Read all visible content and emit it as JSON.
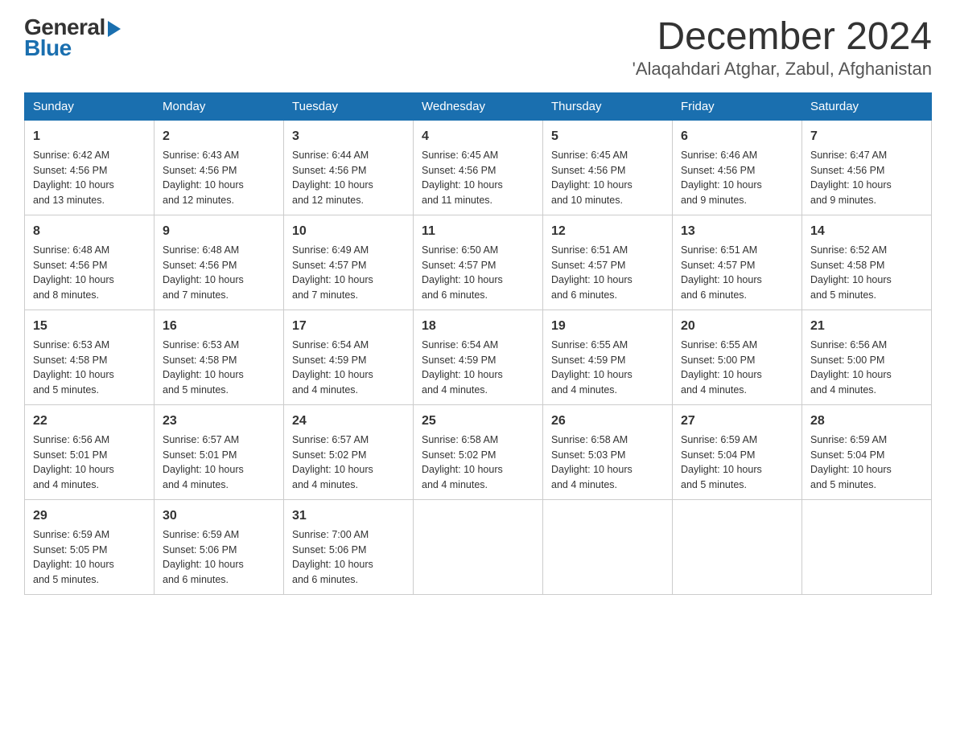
{
  "header": {
    "logo_general": "General",
    "logo_blue": "Blue",
    "month_title": "December 2024",
    "location": "'Alaqahdari Atghar, Zabul, Afghanistan"
  },
  "weekdays": [
    "Sunday",
    "Monday",
    "Tuesday",
    "Wednesday",
    "Thursday",
    "Friday",
    "Saturday"
  ],
  "weeks": [
    [
      {
        "day": "1",
        "sunrise": "6:42 AM",
        "sunset": "4:56 PM",
        "daylight": "10 hours and 13 minutes."
      },
      {
        "day": "2",
        "sunrise": "6:43 AM",
        "sunset": "4:56 PM",
        "daylight": "10 hours and 12 minutes."
      },
      {
        "day": "3",
        "sunrise": "6:44 AM",
        "sunset": "4:56 PM",
        "daylight": "10 hours and 12 minutes."
      },
      {
        "day": "4",
        "sunrise": "6:45 AM",
        "sunset": "4:56 PM",
        "daylight": "10 hours and 11 minutes."
      },
      {
        "day": "5",
        "sunrise": "6:45 AM",
        "sunset": "4:56 PM",
        "daylight": "10 hours and 10 minutes."
      },
      {
        "day": "6",
        "sunrise": "6:46 AM",
        "sunset": "4:56 PM",
        "daylight": "10 hours and 9 minutes."
      },
      {
        "day": "7",
        "sunrise": "6:47 AM",
        "sunset": "4:56 PM",
        "daylight": "10 hours and 9 minutes."
      }
    ],
    [
      {
        "day": "8",
        "sunrise": "6:48 AM",
        "sunset": "4:56 PM",
        "daylight": "10 hours and 8 minutes."
      },
      {
        "day": "9",
        "sunrise": "6:48 AM",
        "sunset": "4:56 PM",
        "daylight": "10 hours and 7 minutes."
      },
      {
        "day": "10",
        "sunrise": "6:49 AM",
        "sunset": "4:57 PM",
        "daylight": "10 hours and 7 minutes."
      },
      {
        "day": "11",
        "sunrise": "6:50 AM",
        "sunset": "4:57 PM",
        "daylight": "10 hours and 6 minutes."
      },
      {
        "day": "12",
        "sunrise": "6:51 AM",
        "sunset": "4:57 PM",
        "daylight": "10 hours and 6 minutes."
      },
      {
        "day": "13",
        "sunrise": "6:51 AM",
        "sunset": "4:57 PM",
        "daylight": "10 hours and 6 minutes."
      },
      {
        "day": "14",
        "sunrise": "6:52 AM",
        "sunset": "4:58 PM",
        "daylight": "10 hours and 5 minutes."
      }
    ],
    [
      {
        "day": "15",
        "sunrise": "6:53 AM",
        "sunset": "4:58 PM",
        "daylight": "10 hours and 5 minutes."
      },
      {
        "day": "16",
        "sunrise": "6:53 AM",
        "sunset": "4:58 PM",
        "daylight": "10 hours and 5 minutes."
      },
      {
        "day": "17",
        "sunrise": "6:54 AM",
        "sunset": "4:59 PM",
        "daylight": "10 hours and 4 minutes."
      },
      {
        "day": "18",
        "sunrise": "6:54 AM",
        "sunset": "4:59 PM",
        "daylight": "10 hours and 4 minutes."
      },
      {
        "day": "19",
        "sunrise": "6:55 AM",
        "sunset": "4:59 PM",
        "daylight": "10 hours and 4 minutes."
      },
      {
        "day": "20",
        "sunrise": "6:55 AM",
        "sunset": "5:00 PM",
        "daylight": "10 hours and 4 minutes."
      },
      {
        "day": "21",
        "sunrise": "6:56 AM",
        "sunset": "5:00 PM",
        "daylight": "10 hours and 4 minutes."
      }
    ],
    [
      {
        "day": "22",
        "sunrise": "6:56 AM",
        "sunset": "5:01 PM",
        "daylight": "10 hours and 4 minutes."
      },
      {
        "day": "23",
        "sunrise": "6:57 AM",
        "sunset": "5:01 PM",
        "daylight": "10 hours and 4 minutes."
      },
      {
        "day": "24",
        "sunrise": "6:57 AM",
        "sunset": "5:02 PM",
        "daylight": "10 hours and 4 minutes."
      },
      {
        "day": "25",
        "sunrise": "6:58 AM",
        "sunset": "5:02 PM",
        "daylight": "10 hours and 4 minutes."
      },
      {
        "day": "26",
        "sunrise": "6:58 AM",
        "sunset": "5:03 PM",
        "daylight": "10 hours and 4 minutes."
      },
      {
        "day": "27",
        "sunrise": "6:59 AM",
        "sunset": "5:04 PM",
        "daylight": "10 hours and 5 minutes."
      },
      {
        "day": "28",
        "sunrise": "6:59 AM",
        "sunset": "5:04 PM",
        "daylight": "10 hours and 5 minutes."
      }
    ],
    [
      {
        "day": "29",
        "sunrise": "6:59 AM",
        "sunset": "5:05 PM",
        "daylight": "10 hours and 5 minutes."
      },
      {
        "day": "30",
        "sunrise": "6:59 AM",
        "sunset": "5:06 PM",
        "daylight": "10 hours and 6 minutes."
      },
      {
        "day": "31",
        "sunrise": "7:00 AM",
        "sunset": "5:06 PM",
        "daylight": "10 hours and 6 minutes."
      },
      null,
      null,
      null,
      null
    ]
  ],
  "labels": {
    "sunrise": "Sunrise:",
    "sunset": "Sunset:",
    "daylight": "Daylight:"
  }
}
